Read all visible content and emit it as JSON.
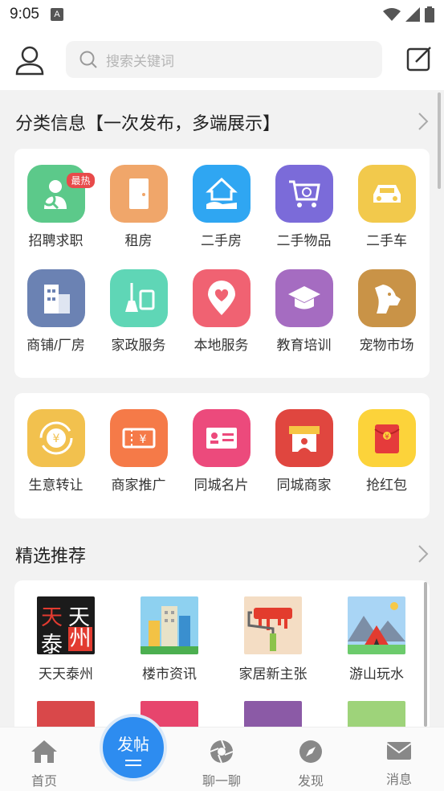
{
  "status_bar": {
    "time": "9:05",
    "notif_glyph": "A"
  },
  "search": {
    "placeholder": "搜索关键词"
  },
  "classified": {
    "title": "分类信息【一次发布，多端展示】",
    "badge": "最热",
    "items": [
      {
        "label": "招聘求职",
        "color": "#5cc98a",
        "icon": "recruit-icon"
      },
      {
        "label": "租房",
        "color": "#f0a66a",
        "icon": "door-icon"
      },
      {
        "label": "二手房",
        "color": "#2fa6f2",
        "icon": "house-hand-icon"
      },
      {
        "label": "二手物品",
        "color": "#7b6bd9",
        "icon": "cart-icon"
      },
      {
        "label": "二手车",
        "color": "#f2c94c",
        "icon": "car-icon"
      },
      {
        "label": "商铺/厂房",
        "color": "#6b82b3",
        "icon": "building-icon"
      },
      {
        "label": "家政服务",
        "color": "#5fd6b6",
        "icon": "broom-icon"
      },
      {
        "label": "本地服务",
        "color": "#f06272",
        "icon": "location-heart-icon"
      },
      {
        "label": "教育培训",
        "color": "#a56cc1",
        "icon": "graduation-cap-icon"
      },
      {
        "label": "宠物市场",
        "color": "#c99347",
        "icon": "dog-icon"
      }
    ]
  },
  "services": {
    "items": [
      {
        "label": "生意转让",
        "color": "#f2c14e",
        "icon": "transfer-icon"
      },
      {
        "label": "商家推广",
        "color": "#f57a48",
        "icon": "ticket-icon"
      },
      {
        "label": "同城名片",
        "color": "#ec4a7c",
        "icon": "card-icon"
      },
      {
        "label": "同城商家",
        "color": "#e0463f",
        "icon": "store-icon"
      },
      {
        "label": "抢红包",
        "color": "#fcd33a",
        "icon": "red-envelope-icon"
      }
    ]
  },
  "featured": {
    "title": "精选推荐",
    "items": [
      {
        "label": "天天泰州",
        "icon": "tiantian-taizhou-logo"
      },
      {
        "label": "楼市资讯",
        "icon": "buildings-icon"
      },
      {
        "label": "家居新主张",
        "icon": "paint-roller-icon"
      },
      {
        "label": "游山玩水",
        "icon": "tent-icon"
      }
    ],
    "logo_text": [
      "天",
      "天",
      "泰",
      "州"
    ]
  },
  "bottom_nav": {
    "home": "首页",
    "post": "发帖",
    "chat": "聊一聊",
    "discover": "发现",
    "messages": "消息"
  }
}
